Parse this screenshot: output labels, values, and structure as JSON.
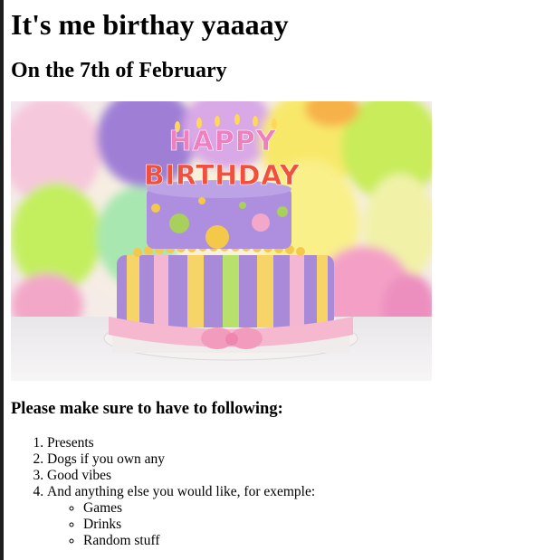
{
  "page": {
    "title": "It's me birthay yaaaay",
    "subtitle": "On the 7th of February",
    "image": {
      "alt": "birthday-cake-photo",
      "candle_text_line1": "HAPPY",
      "candle_text_line2": "BIRTHDAY"
    },
    "instructions_heading": "Please make sure to have to following:",
    "list_items": [
      "Presents",
      "Dogs if you own any",
      "Good vibes",
      "And anything else you would like, for exemple:"
    ],
    "sub_items": [
      "Games",
      "Drinks",
      "Random stuff"
    ]
  }
}
